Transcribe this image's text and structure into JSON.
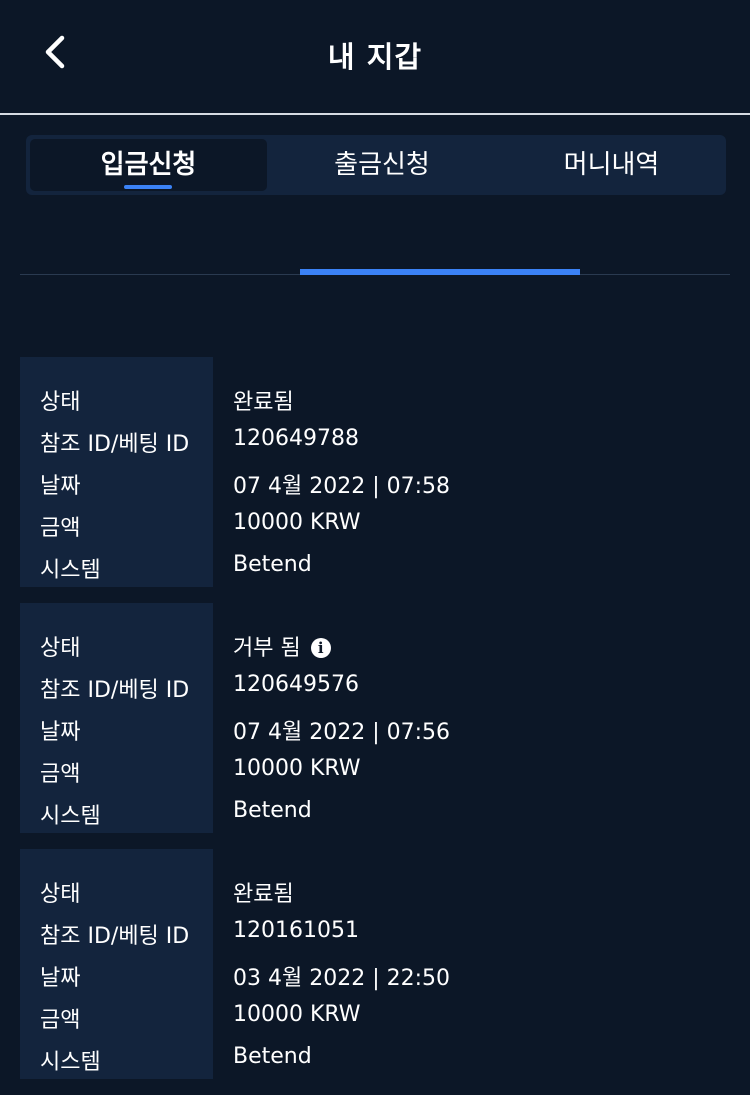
{
  "header": {
    "title": "내 지갑",
    "back_icon": "chevron-left-icon"
  },
  "tabs": [
    {
      "label": "입금신청",
      "active": true
    },
    {
      "label": "출금신청",
      "active": false
    },
    {
      "label": "머니내역",
      "active": false
    }
  ],
  "colors": {
    "background": "#0c1727",
    "panel": "#13243d",
    "accent": "#3b82f6",
    "text": "#ffffff"
  },
  "labels": {
    "status": "상태",
    "ref": "참조 ID/베팅 ID",
    "date": "날짜",
    "amount": "금액",
    "system": "시스템"
  },
  "records": [
    {
      "status": "완료됨",
      "ref": "120649788",
      "date": "07 4월 2022 | 07:58",
      "amount": "10000 KRW",
      "system": "Betend",
      "info_icon": false
    },
    {
      "status": "거부 됨",
      "ref": "120649576",
      "date": "07 4월 2022 | 07:56",
      "amount": "10000 KRW",
      "system": "Betend",
      "info_icon": true
    },
    {
      "status": "완료됨",
      "ref": "120161051",
      "date": "03 4월 2022 | 22:50",
      "amount": "10000 KRW",
      "system": "Betend",
      "info_icon": false
    }
  ]
}
